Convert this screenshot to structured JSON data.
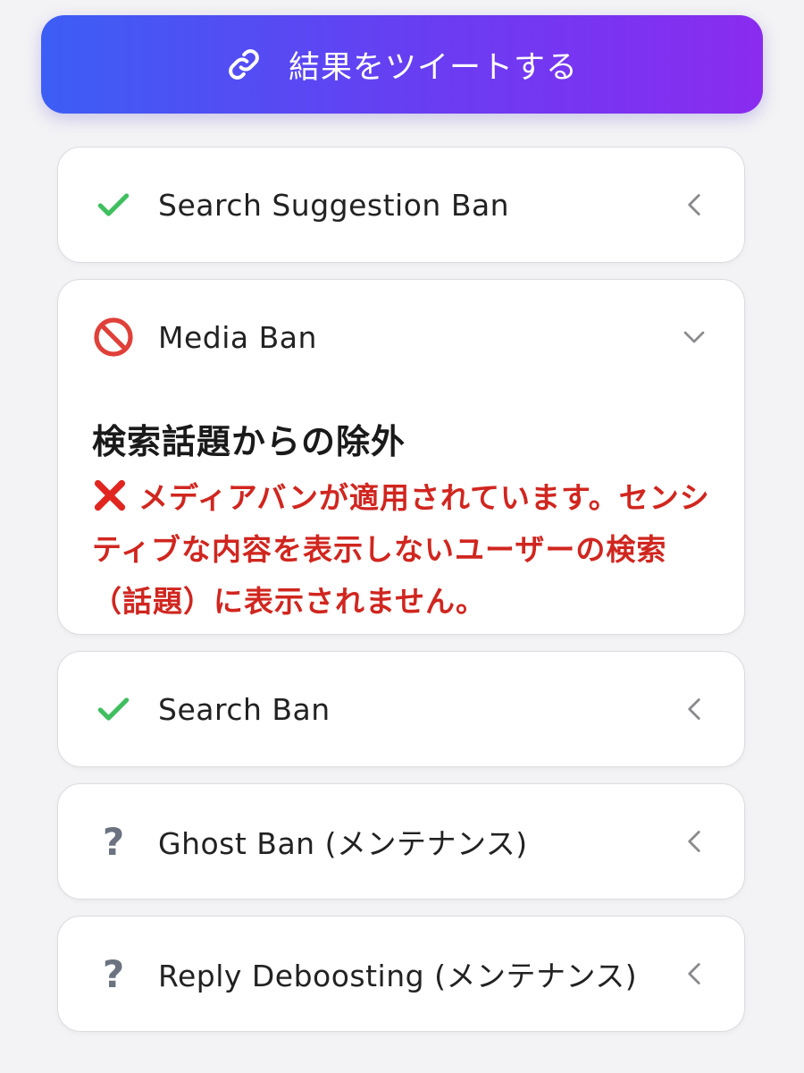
{
  "tweet_button": {
    "label": "結果をツイートする",
    "icon": "link-icon",
    "gradient_start": "#3c5ef5",
    "gradient_end": "#8a2cf0"
  },
  "checks": [
    {
      "title": "Search Suggestion Ban",
      "status": "ok",
      "status_icon": "check-icon",
      "expanded": false
    },
    {
      "title": "Media Ban",
      "status": "banned",
      "status_icon": "prohibited-icon",
      "expanded": true,
      "detail_heading": "検索話題からの除外",
      "detail_text": "メディアバンが適用されています。センシティブな内容を表示しないユーザーの検索（話題）に表示されません。"
    },
    {
      "title": "Search Ban",
      "status": "ok",
      "status_icon": "check-icon",
      "expanded": false
    },
    {
      "title": "Ghost Ban (メンテナンス)",
      "status": "unknown",
      "status_icon": "question-icon",
      "expanded": false
    },
    {
      "title": "Reply Deboosting (メンテナンス)",
      "status": "unknown",
      "status_icon": "question-icon",
      "expanded": false
    }
  ],
  "colors": {
    "ok": "#3fbf5f",
    "banned": "#e0403a",
    "unknown": "#6b7280",
    "detail_text": "#d0261f"
  }
}
